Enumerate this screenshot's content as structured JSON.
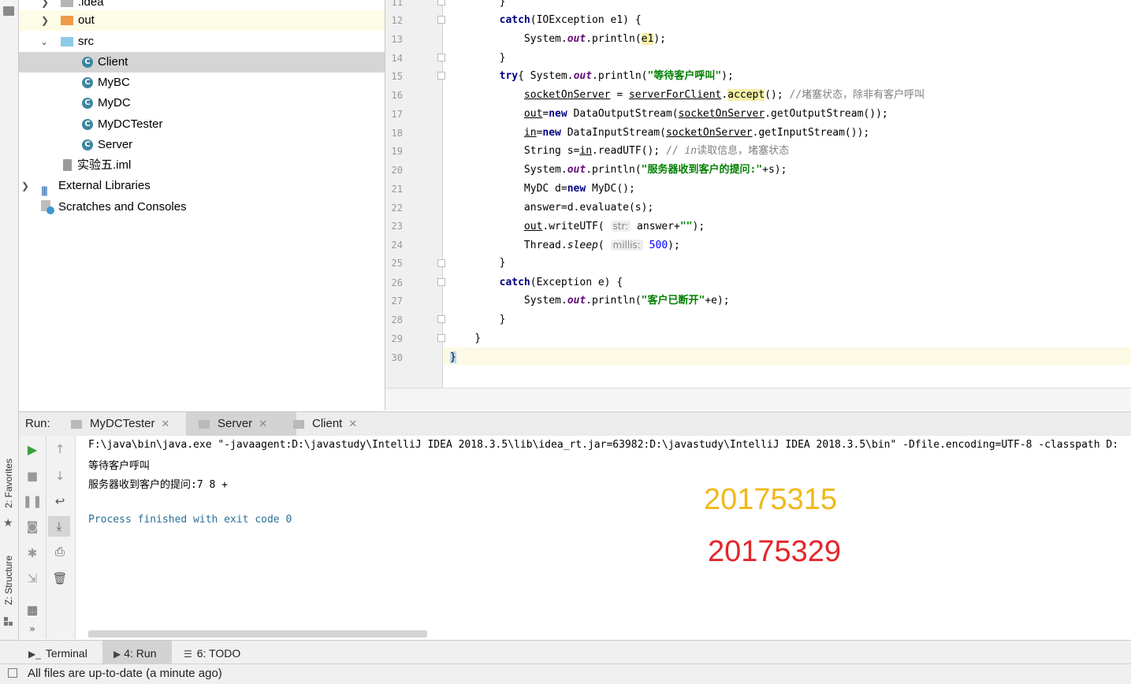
{
  "side_strip": {
    "favorites_label": "2: Favorites",
    "structure_label": "Z: Structure"
  },
  "project_tree": {
    "items": [
      {
        "label": ".idea"
      },
      {
        "label": "out"
      },
      {
        "label": "src"
      },
      {
        "label": "Client"
      },
      {
        "label": "MyBC"
      },
      {
        "label": "MyDC"
      },
      {
        "label": "MyDCTester"
      },
      {
        "label": "Server"
      },
      {
        "label": "实验五.iml"
      },
      {
        "label": "External Libraries"
      },
      {
        "label": "Scratches and Consoles"
      }
    ]
  },
  "editor": {
    "line_numbers": [
      "11",
      "12",
      "13",
      "14",
      "15",
      "16",
      "17",
      "18",
      "19",
      "20",
      "21",
      "22",
      "23",
      "24",
      "25",
      "26",
      "27",
      "28",
      "29",
      "30"
    ],
    "hints": {
      "str": "str:",
      "millis": "millis:"
    }
  },
  "run": {
    "label": "Run:",
    "tabs": [
      {
        "label": "MyDCTester"
      },
      {
        "label": "Server"
      },
      {
        "label": "Client"
      }
    ],
    "console_lines": [
      "F:\\java\\bin\\java.exe \"-javaagent:D:\\javastudy\\IntelliJ IDEA 2018.3.5\\lib\\idea_rt.jar=63982:D:\\javastudy\\IntelliJ IDEA 2018.3.5\\bin\" -Dfile.encoding=UTF-8 -classpath D:",
      "等待客户呼叫",
      "服务器收到客户的提问:7 8 +",
      "",
      "Process finished with exit code 0"
    ],
    "overlay_ids": [
      "20175315",
      "20175329"
    ],
    "overlay_colors": [
      "#f0b81c",
      "#e3262a"
    ]
  },
  "bottom_tabs": [
    {
      "label": "Terminal"
    },
    {
      "label": "4: Run"
    },
    {
      "label": "6: TODO"
    }
  ],
  "status": {
    "text": "All files are up-to-date (a minute ago)"
  }
}
